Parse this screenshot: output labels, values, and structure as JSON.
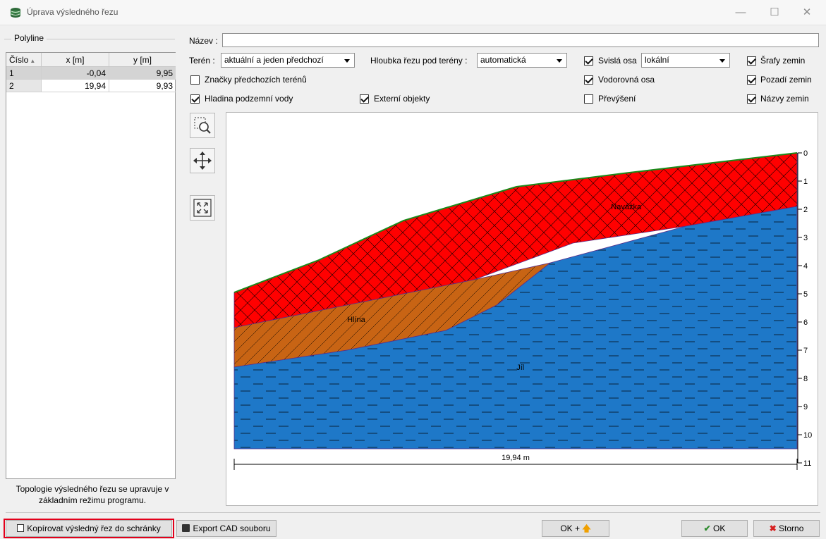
{
  "window": {
    "title": "Úprava výsledného řezu",
    "minimize": "—",
    "maximize": "☐",
    "close": "✕"
  },
  "polyline": {
    "legend": "Polyline",
    "columns": [
      "Číslo",
      "x [m]",
      "y [m]"
    ],
    "rows": [
      {
        "num": "1",
        "x": "-0,04",
        "y": "9,95"
      },
      {
        "num": "2",
        "x": "19,94",
        "y": "9,93"
      }
    ],
    "note_line1": "Topologie výsledného řezu se upravuje v",
    "note_line2": "základním režimu programu."
  },
  "form": {
    "name_label": "Název :",
    "name_value": "",
    "terrain_label": "Terén :",
    "terrain_value": "aktuální a jeden předchozí",
    "depth_label": "Hloubka řezu pod terény :",
    "depth_value": "automatická",
    "vertical_axis_label": "Svislá osa",
    "vertical_axis_checked": true,
    "vertical_axis_value": "lokální",
    "hatch_label": "Šrafy zemin",
    "hatch_checked": true,
    "prev_terrain_marks_label": "Značky předchozích terénů",
    "prev_terrain_marks_checked": false,
    "horizontal_axis_label": "Vodorovná osa",
    "horizontal_axis_checked": true,
    "soil_background_label": "Pozadí zemin",
    "soil_background_checked": true,
    "groundwater_label": "Hladina podzemní vody",
    "groundwater_checked": true,
    "external_objects_label": "Externí objekty",
    "external_objects_checked": true,
    "exaggeration_label": "Převýšení",
    "exaggeration_checked": false,
    "soil_names_label": "Názvy zemin",
    "soil_names_checked": true
  },
  "tools": {
    "zoom_icon": "zoom-region-icon",
    "pan_icon": "move-arrows-icon",
    "fit_icon": "fit-to-view-icon"
  },
  "chart_data": {
    "type": "area",
    "title": "",
    "xlabel": "",
    "ylabel": "",
    "x_extent_label": "19,94 m",
    "x_range": [
      0,
      19.94
    ],
    "ylim": [
      0,
      11
    ],
    "y_inverted": true,
    "y_ticks": [
      "0",
      "1",
      "2",
      "3",
      "4",
      "5",
      "6",
      "7",
      "8",
      "9",
      "10",
      "11"
    ],
    "series": [
      {
        "name": "Navážka",
        "color": "#ff0000",
        "hatch": "cross",
        "top": [
          [
            0,
            4.95
          ],
          [
            3,
            3.8
          ],
          [
            6,
            2.4
          ],
          [
            10,
            1.2
          ],
          [
            14,
            0.7
          ],
          [
            19.94,
            0
          ]
        ],
        "bottom": [
          [
            0,
            6.2
          ],
          [
            4,
            5.4
          ],
          [
            8.5,
            4.5
          ],
          [
            12,
            3.2
          ],
          [
            16,
            2.6
          ],
          [
            19.94,
            1.9
          ]
        ]
      },
      {
        "name": "Hlína",
        "color": "#c86414",
        "hatch": "diagonal",
        "top": [
          [
            0,
            6.2
          ],
          [
            4,
            5.4
          ],
          [
            8.5,
            4.5
          ],
          [
            11.2,
            3.9
          ]
        ],
        "bottom": [
          [
            0,
            7.6
          ],
          [
            4,
            7.0
          ],
          [
            7.5,
            6.3
          ],
          [
            9.3,
            5.4
          ],
          [
            11.2,
            3.9
          ]
        ]
      },
      {
        "name": "Jíl",
        "color": "#1e78c8",
        "hatch": "dash",
        "top": [
          [
            0,
            7.6
          ],
          [
            4,
            7.0
          ],
          [
            7.5,
            6.3
          ],
          [
            9.3,
            5.4
          ],
          [
            11.2,
            3.9
          ],
          [
            16,
            2.6
          ],
          [
            19.94,
            1.9
          ]
        ],
        "bottom": [
          [
            0,
            10.5
          ],
          [
            19.94,
            10.5
          ]
        ]
      }
    ],
    "label_positions": {
      "Navážka": [
        13.35,
        2.0
      ],
      "Hlína": [
        4.0,
        6.0
      ],
      "Jíl": [
        10.0,
        7.7
      ]
    }
  },
  "buttons": {
    "copy": "Kopírovat výsledný řez do schránky",
    "export": "Export CAD souboru",
    "ok_plus": "OK +",
    "ok": "OK",
    "cancel": "Storno"
  }
}
